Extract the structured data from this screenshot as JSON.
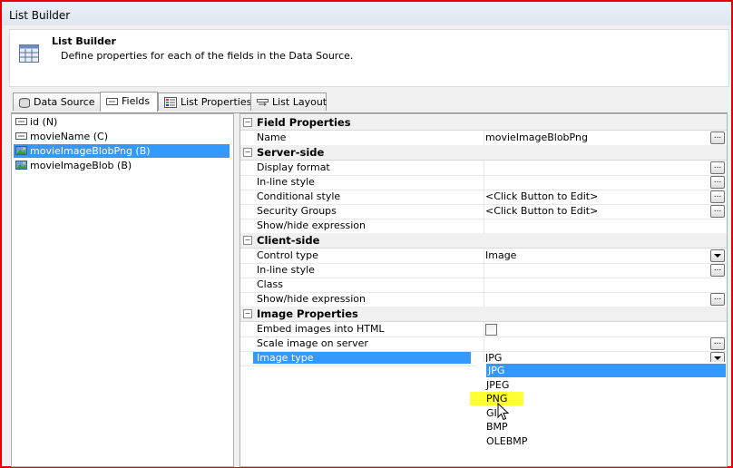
{
  "window": {
    "title": "List Builder"
  },
  "header": {
    "title": "List Builder",
    "description": "Define properties for each of the fields in the Data Source."
  },
  "tabs": [
    {
      "label": "Data Source",
      "icon": "database-icon"
    },
    {
      "label": "Fields",
      "icon": "field-icon",
      "active": true
    },
    {
      "label": "List Properties",
      "icon": "properties-icon"
    },
    {
      "label": "List Layout",
      "icon": "layout-icon"
    }
  ],
  "fields": [
    {
      "label": "id (N)",
      "icon": "text-field-icon"
    },
    {
      "label": "movieName (C)",
      "icon": "text-field-icon"
    },
    {
      "label": "movieImageBlobPng (B)",
      "icon": "image-field-icon",
      "selected": true
    },
    {
      "label": "movieImageBlob (B)",
      "icon": "image-field-icon"
    }
  ],
  "properties": {
    "field_properties": {
      "title": "Field Properties",
      "name_label": "Name",
      "name_value": "movieImageBlobPng"
    },
    "server_side": {
      "title": "Server-side",
      "display_format": "Display format",
      "inline_style": "In-line style",
      "conditional_style": "Conditional style",
      "conditional_style_value": "<Click Button to Edit>",
      "security_groups": "Security Groups",
      "security_groups_value": "<Click Button to Edit>",
      "show_hide": "Show/hide expression"
    },
    "client_side": {
      "title": "Client-side",
      "control_type": "Control type",
      "control_type_value": "Image",
      "inline_style": "In-line style",
      "class": "Class",
      "show_hide": "Show/hide expression"
    },
    "image_properties": {
      "title": "Image Properties",
      "embed": "Embed images into HTML",
      "scale": "Scale image on server",
      "image_type": "Image type",
      "image_type_value": "JPG"
    }
  },
  "ellipsis": "...",
  "image_type_options": [
    "JPG",
    "JPEG",
    "PNG",
    "GIF",
    "BMP",
    "OLEBMP"
  ],
  "colors": {
    "selection": "#3399ff",
    "highlight": "#ffff33",
    "frame": "#e00000"
  }
}
